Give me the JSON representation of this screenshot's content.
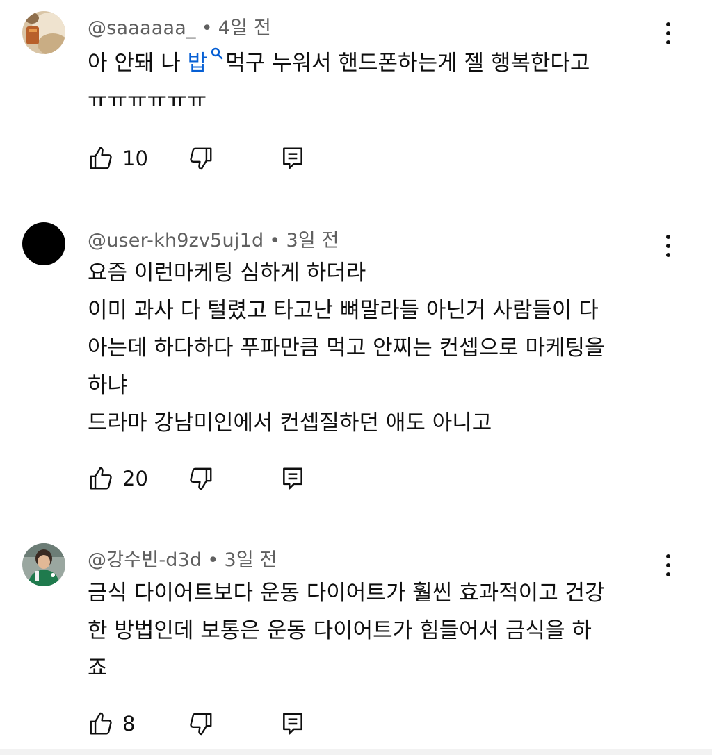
{
  "comments": [
    {
      "author": "@saaaaaa_",
      "separator": "•",
      "time": "4일 전",
      "line1_pre": "아 안돼 나 ",
      "line1_link": "밥",
      "line1_post": "먹구 누워서 핸드폰하는게 젤 행복한다고",
      "line2": "ㅠㅠㅠㅠㅠㅠ",
      "likes": "10",
      "avatar": "photo"
    },
    {
      "author": "@user-kh9zv5uj1d",
      "separator": "•",
      "time": "3일 전",
      "lines": [
        "요즘 이런마케팅 심하게 하더라",
        "이미 과사 다 털렸고 타고난 뼈말라들 아닌거 사람들이 다",
        "아는데 하다하다 푸파만큼 먹고 안찌는 컨셉으로 마케팅을",
        "하냐",
        "드라마 강남미인에서 컨셉질하던 애도 아니고"
      ],
      "likes": "20",
      "avatar": "black-circle"
    },
    {
      "author": "@강수빈-d3d",
      "separator": "•",
      "time": "3일 전",
      "lines": [
        "금식 다이어트보다 운동 다이어트가 훨씬 효과적이고 건강",
        "한 방법인데 보통은 운동 다이어트가 힘들어서 금식을 하",
        "죠"
      ],
      "likes": "8",
      "avatar": "photo"
    }
  ],
  "icons": {
    "like": "thumb-up-icon",
    "dislike": "thumb-down-icon",
    "reply": "reply-icon",
    "more": "more-vert-icon",
    "search": "search-icon"
  },
  "colors": {
    "link": "#065fd4",
    "meta": "#606060",
    "text": "#0f0f0f"
  }
}
